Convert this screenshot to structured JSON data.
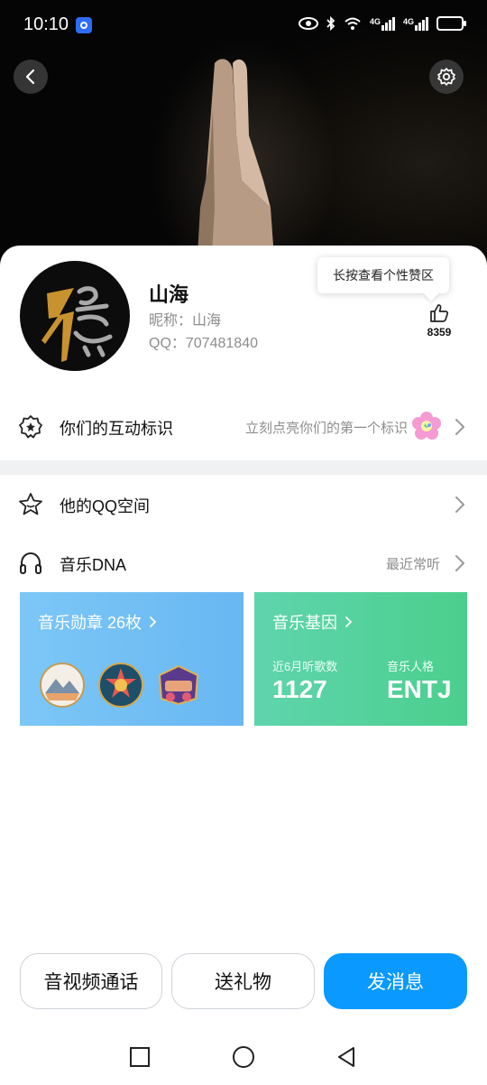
{
  "status_bar": {
    "time": "10:10",
    "signal_1": "4G",
    "signal_2": "4G"
  },
  "profile": {
    "name": "山海",
    "nickname_label": "昵称：",
    "nickname": "山海",
    "qq_label": "QQ：",
    "qq_number": "707481840",
    "like_count": "8359",
    "tooltip": "长按查看个性赞区"
  },
  "interaction_row": {
    "label": "你们的互动标识",
    "hint": "立刻点亮你们的第一个标识"
  },
  "qzone_row": {
    "label": "他的QQ空间"
  },
  "music_row": {
    "label": "音乐DNA",
    "hint": "最近常听"
  },
  "music_badges_tile": {
    "title": "音乐勋章 26枚"
  },
  "music_gene_tile": {
    "title": "音乐基因",
    "stat1_label": "近6月听歌数",
    "stat1_value": "1127",
    "stat2_label": "音乐人格",
    "stat2_value": "ENTJ"
  },
  "actions": {
    "call": "音视频通话",
    "gift": "送礼物",
    "message": "发消息"
  },
  "colors": {
    "primary": "#0a99ff",
    "tile_blue": "#7cc7f6",
    "tile_green": "#4bcf8d"
  },
  "icons": [
    "back-icon",
    "settings-icon",
    "thumbs-up-icon",
    "badge-star-icon",
    "flower-icon",
    "star-face-icon",
    "headphones-icon",
    "chevron-right-icon",
    "square-icon",
    "circle-icon",
    "triangle-back-icon"
  ]
}
